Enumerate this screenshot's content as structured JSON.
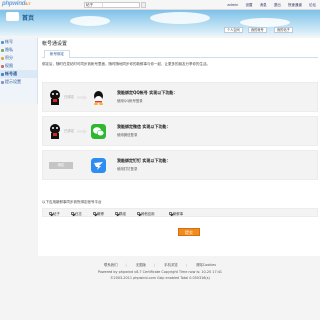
{
  "topbar": {
    "logo_main": "phpwind",
    "logo_version": "8.7",
    "search_scope": "帖子",
    "user": "admin",
    "links": [
      "设置",
      "消息",
      "退出",
      "快速通道",
      "论坛"
    ]
  },
  "hero": {
    "site_name": "首页",
    "buttons": [
      "个人空间",
      "我的帐号",
      "我的帖子"
    ]
  },
  "sidebar": {
    "items": [
      {
        "label": "帐号"
      },
      {
        "label": "隐私"
      },
      {
        "label": "积分"
      },
      {
        "label": "权限"
      },
      {
        "label": "帐号通"
      },
      {
        "label": "提示设置"
      }
    ]
  },
  "main": {
    "page_title": "帐号通设置",
    "tab": "帐号绑定",
    "intro": "绑定后，随时在发帖时可同步到帐号里面，随时随地同步你的新鲜事与你一起，让更多的朋友分享你的生活。",
    "cards": [
      {
        "state": "已绑定",
        "title": "我能绑定QQ帐号 实现以下功能：",
        "subtitle": "使用QQ帐号登录",
        "color": "#1a1a1a"
      },
      {
        "state": "已绑定",
        "title": "我能绑定微信 实现以下功能：",
        "subtitle": "使用微信登录",
        "color": "#2fb82f"
      },
      {
        "state": "绑定",
        "title": "我能绑定钉钉 实现以下功能：",
        "subtitle": "使用钉钉登录",
        "color": "#2e8df0"
      }
    ],
    "sync_note": "以下应用新鲜事同步到所绑定帐号平台",
    "sync_items": [
      "帖子",
      "日志",
      "微博",
      "群组",
      "其他应用",
      "新鲜事"
    ],
    "submit": "提交"
  },
  "footer": {
    "links": [
      "联系我们",
      "无图版",
      "手机浏览",
      "清除Cookies"
    ],
    "line1": "Powered by phpwind v8.7 Certificate Copyright Time now is: 10-20 17:41",
    "line2": "©2003-2011 phpwind.com Gzip enabled Total 0.050316(s)"
  },
  "colors": {
    "accent": "#f28a1e",
    "link": "#2a5b96",
    "hero": "#7ec1e8"
  }
}
